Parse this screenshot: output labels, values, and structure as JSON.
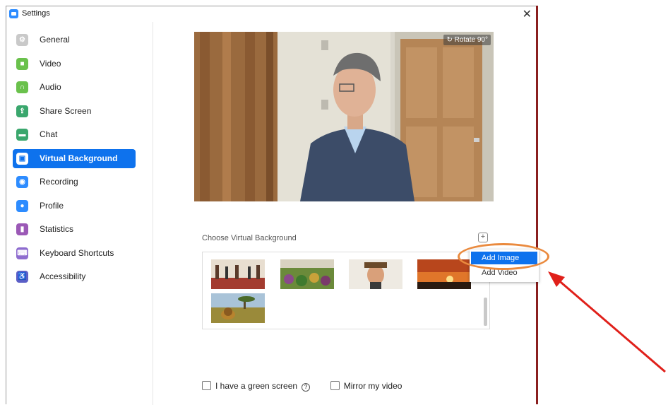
{
  "window": {
    "title": "Settings",
    "close_glyph": "✕"
  },
  "sidebar": {
    "items": [
      {
        "label": "General",
        "icon": "gear-icon",
        "color": "#c9c9c9",
        "active": false
      },
      {
        "label": "Video",
        "icon": "video-camera-icon",
        "color": "#6ac14c",
        "active": false
      },
      {
        "label": "Audio",
        "icon": "headphones-icon",
        "color": "#6ac14c",
        "active": false
      },
      {
        "label": "Share Screen",
        "icon": "share-screen-icon",
        "color": "#3aa76d",
        "active": false
      },
      {
        "label": "Chat",
        "icon": "chat-bubble-icon",
        "color": "#3aa76d",
        "active": false
      },
      {
        "label": "Virtual Background",
        "icon": "portrait-icon",
        "color": "#0e72ed",
        "active": true
      },
      {
        "label": "Recording",
        "icon": "record-icon",
        "color": "#2d8cff",
        "active": false
      },
      {
        "label": "Profile",
        "icon": "user-icon",
        "color": "#2d8cff",
        "active": false
      },
      {
        "label": "Statistics",
        "icon": "bar-chart-icon",
        "color": "#9b59b6",
        "active": false
      },
      {
        "label": "Keyboard Shortcuts",
        "icon": "keyboard-icon",
        "color": "#8e6ccf",
        "active": false
      },
      {
        "label": "Accessibility",
        "icon": "accessibility-icon",
        "color": "#5b5fc7",
        "active": false
      }
    ]
  },
  "main": {
    "rotate_label": "Rotate 90°",
    "choose_label": "Choose Virtual Background",
    "add_glyph": "+",
    "green_screen_label": "I have a green screen",
    "help_glyph": "?",
    "mirror_label": "Mirror my video"
  },
  "dropdown": {
    "add_image": "Add Image",
    "add_video": "Add Video"
  },
  "colors": {
    "accent": "#0e72ed",
    "highlight_oval": "#ea8a3e",
    "arrow": "#e0201a"
  }
}
